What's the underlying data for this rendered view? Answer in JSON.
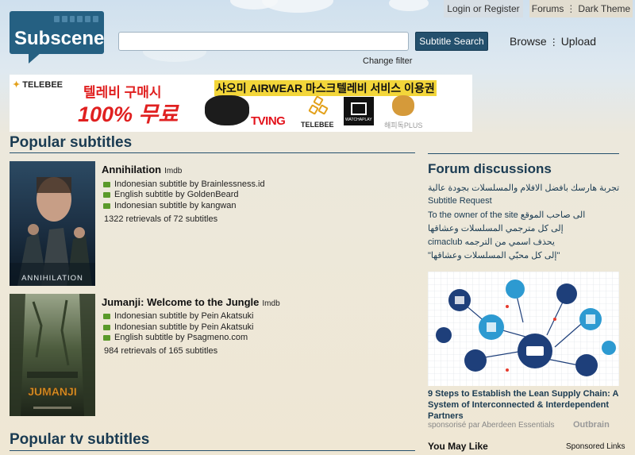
{
  "header": {
    "login": "Login or Register",
    "forums": "Forums",
    "dark_theme": "Dark Theme",
    "logo": "Subscene",
    "search_value": "",
    "search_button": "Subtitle Search",
    "change_filter": "Change filter",
    "browse": "Browse",
    "upload": "Upload"
  },
  "banner": {
    "brand": "TELEBEE",
    "line1": "텔레비 구매시",
    "line2": "100% 무료",
    "promo1": "샤오미 AIRWEAR 마스크",
    "promo2": "텔레비 서비스 이용권",
    "tving": "TVING",
    "telebee_small": "TELEBEE",
    "watcha": "WATCHAPLAY",
    "plus": "해피독PLUS"
  },
  "popular": {
    "title": "Popular subtitles",
    "films": [
      {
        "title": "Annihilation",
        "imdb": "Imdb",
        "poster_text": "ANNIHILATION",
        "subs": [
          "Indonesian subtitle by Brainlessness.id",
          "English subtitle by GoldenBeard",
          "Indonesian subtitle by kangwan"
        ],
        "retrievals": "1322 retrievals of 72 subtitles"
      },
      {
        "title": "Jumanji: Welcome to the Jungle",
        "imdb": "Imdb",
        "poster_text": "JUMANJI",
        "subs": [
          "Indonesian subtitle by Pein Akatsuki",
          "Indonesian subtitle by Pein Akatsuki",
          "English subtitle by Psagmeno.com"
        ],
        "retrievals": "984 retrievals of 165 subtitles"
      }
    ],
    "tv_title": "Popular tv subtitles"
  },
  "forum": {
    "title": "Forum discussions",
    "items": [
      "تجربة هارسك بافضل الافلام والمسلسلات بجودة عالية",
      "Subtitle Request",
      "To the owner of the site الى صاحب الموقع",
      "إلى كل مترجمي المسلسلات وعشاقها",
      "cimaclub يحذف اسمي من الترجمه",
      "\"إلى كل محبّي المسلسلات وعشاقها\""
    ]
  },
  "ad": {
    "title": "9 Steps to Establish the Lean Supply Chain: A System of Interconnected & Interdependent Partners",
    "source": "sponsorisé par Aberdeen Essentials",
    "outbrain": "Outbrain",
    "you_may_like": "You May Like",
    "sponsored": "Sponsored Links"
  }
}
